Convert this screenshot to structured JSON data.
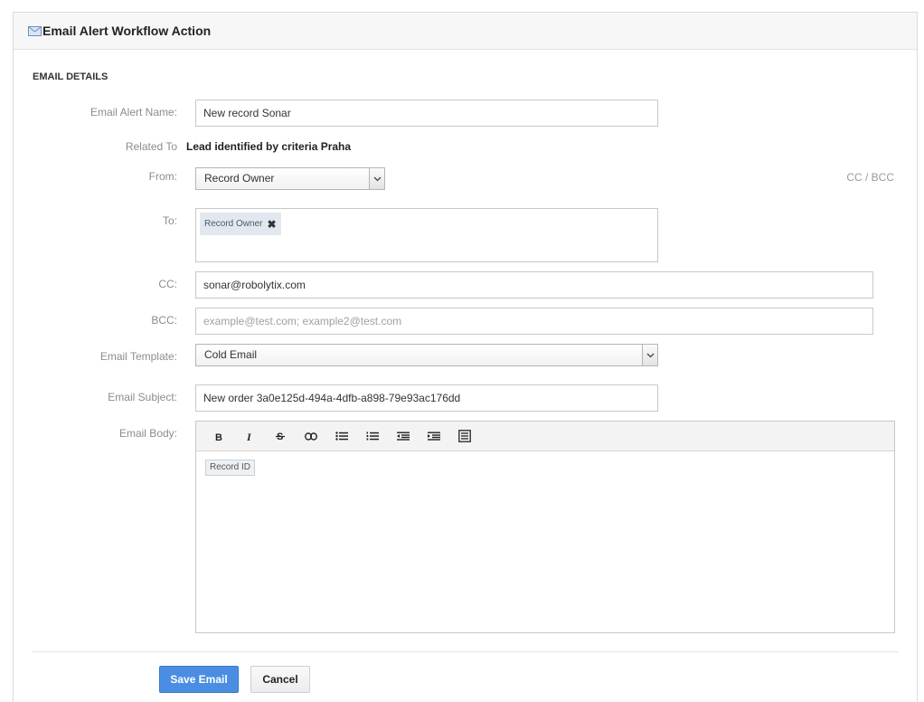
{
  "panel": {
    "title": "Email Alert Workflow Action",
    "icon": "envelope-icon"
  },
  "section": {
    "title": "EMAIL DETAILS"
  },
  "form": {
    "alert_name": {
      "label": "Email Alert Name:",
      "value": "New record Sonar"
    },
    "related_to": {
      "label": "Related To",
      "value": "Lead identified by criteria Praha"
    },
    "from": {
      "label": "From:",
      "selected": "Record Owner"
    },
    "cc_bcc_link": "CC / BCC",
    "to": {
      "label": "To:",
      "recipients": [
        {
          "label": "Record Owner"
        }
      ]
    },
    "cc": {
      "label": "CC:",
      "value": "sonar@robolytix.com"
    },
    "bcc": {
      "label": "BCC:",
      "value": "",
      "placeholder": "example@test.com; example2@test.com"
    },
    "template": {
      "label": "Email Template:",
      "selected": "Cold Email"
    },
    "subject": {
      "label": "Email Subject:",
      "value": "New order 3a0e125d-494a-4dfb-a898-79e93ac176dd"
    },
    "body": {
      "label": "Email Body:",
      "toolbar": [
        "bold-icon",
        "italic-icon",
        "strikethrough-icon",
        "link-icon",
        "bulleted-list-icon",
        "numbered-list-icon",
        "outdent-icon",
        "indent-icon",
        "source-icon"
      ],
      "merge_fields": [
        "Record ID"
      ]
    }
  },
  "actions": {
    "save_label": "Save Email",
    "cancel_label": "Cancel"
  },
  "colors": {
    "primary": "#4a8ee3",
    "chip_bg": "#e1e8ef",
    "label_gray": "#8c8c8c"
  }
}
